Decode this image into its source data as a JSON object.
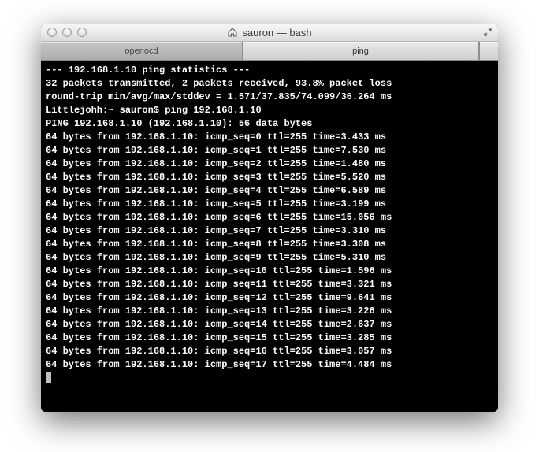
{
  "window": {
    "title": "sauron — bash"
  },
  "tabs": {
    "tab1": "openocd",
    "tab2": "ping"
  },
  "term": {
    "stats_header": "--- 192.168.1.10 ping statistics ---",
    "stats_line1": "32 packets transmitted, 2 packets received, 93.8% packet loss",
    "stats_line2": "round-trip min/avg/max/stddev = 1.571/37.835/74.099/36.264 ms",
    "prompt": "Littlejohh:~ sauron$ ping 192.168.1.10",
    "ping_start": "PING 192.168.1.10 (192.168.1.10): 56 data bytes",
    "r0": "64 bytes from 192.168.1.10: icmp_seq=0 ttl=255 time=3.433 ms",
    "r1": "64 bytes from 192.168.1.10: icmp_seq=1 ttl=255 time=7.530 ms",
    "r2": "64 bytes from 192.168.1.10: icmp_seq=2 ttl=255 time=1.480 ms",
    "r3": "64 bytes from 192.168.1.10: icmp_seq=3 ttl=255 time=5.520 ms",
    "r4": "64 bytes from 192.168.1.10: icmp_seq=4 ttl=255 time=6.589 ms",
    "r5": "64 bytes from 192.168.1.10: icmp_seq=5 ttl=255 time=3.199 ms",
    "r6": "64 bytes from 192.168.1.10: icmp_seq=6 ttl=255 time=15.056 ms",
    "r7": "64 bytes from 192.168.1.10: icmp_seq=7 ttl=255 time=3.310 ms",
    "r8": "64 bytes from 192.168.1.10: icmp_seq=8 ttl=255 time=3.308 ms",
    "r9": "64 bytes from 192.168.1.10: icmp_seq=9 ttl=255 time=5.310 ms",
    "r10": "64 bytes from 192.168.1.10: icmp_seq=10 ttl=255 time=1.596 ms",
    "r11": "64 bytes from 192.168.1.10: icmp_seq=11 ttl=255 time=3.321 ms",
    "r12": "64 bytes from 192.168.1.10: icmp_seq=12 ttl=255 time=9.641 ms",
    "r13": "64 bytes from 192.168.1.10: icmp_seq=13 ttl=255 time=3.226 ms",
    "r14": "64 bytes from 192.168.1.10: icmp_seq=14 ttl=255 time=2.637 ms",
    "r15": "64 bytes from 192.168.1.10: icmp_seq=15 ttl=255 time=3.285 ms",
    "r16": "64 bytes from 192.168.1.10: icmp_seq=16 ttl=255 time=3.057 ms",
    "r17": "64 bytes from 192.168.1.10: icmp_seq=17 ttl=255 time=4.484 ms"
  }
}
